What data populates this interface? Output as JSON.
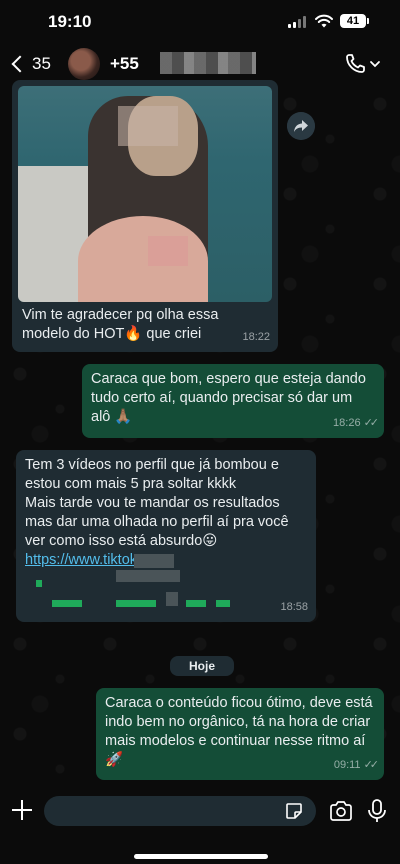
{
  "status_bar": {
    "time": "19:10",
    "battery": "41"
  },
  "header": {
    "back_count": "35",
    "contact_name": "+55 "
  },
  "messages": [
    {
      "id": "m0",
      "direction": "incoming",
      "has_image": true,
      "text": "Vim te agradecer pq olha essa modelo do HOT🔥 que criei",
      "time": "18:22"
    },
    {
      "id": "m1",
      "direction": "outgoing",
      "text": "Caraca que bom, espero que esteja dando tudo certo aí, quando precisar só dar um alô 🙏🏽",
      "time": "18:26"
    },
    {
      "id": "m2",
      "direction": "incoming",
      "text": "Tem 3 vídeos no perfil que já bombou e estou com mais 5 pra soltar kkkk\nMais tarde vou te mandar os resultados mas dar uma olhada no perfil aí pra você ver como isso está absurdo😛",
      "link": "https://www.tiktok.co",
      "time": "18:58"
    },
    {
      "id": "m3",
      "direction": "outgoing",
      "text": "Caraca o conteúdo ficou ótimo, deve está indo bem no orgânico, tá na hora de criar mais modelos e continuar nesse ritmo aí🚀",
      "time": "09:11"
    }
  ],
  "date_separator": "Hoje",
  "colors": {
    "incoming_bubble": "#1f2c33",
    "outgoing_bubble": "#144d37",
    "link": "#53bdeb",
    "background": "#0b0b0b"
  },
  "icons": {
    "back": "chevron-left-icon",
    "call": "phone-icon",
    "forward": "forward-icon",
    "attach": "plus-icon",
    "sticker": "sticker-icon",
    "camera": "camera-icon",
    "mic": "microphone-icon"
  }
}
